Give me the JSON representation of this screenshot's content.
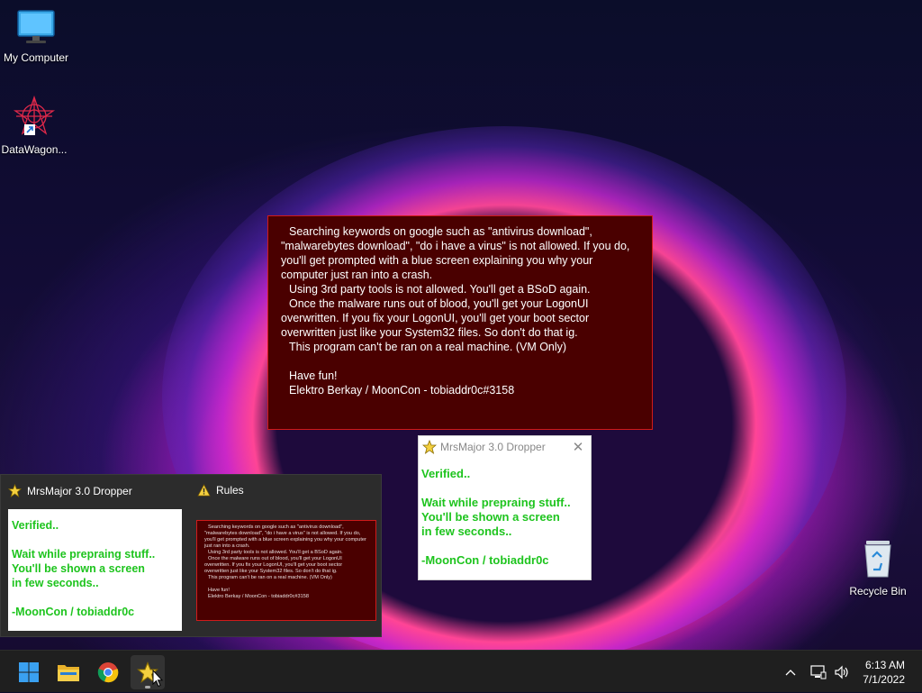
{
  "desktop": {
    "icons": [
      {
        "label": "My Computer"
      },
      {
        "label": "DataWagon..."
      },
      {
        "label": "Recycle Bin"
      }
    ]
  },
  "rules_window": {
    "lines": [
      "Searching keywords on google such as \"antivirus download\", \"malwarebytes download\", \"do i have a virus\" is not allowed. If you do, you'll get prompted with a blue screen explaining you why your computer just ran into a crash.",
      "Using 3rd party tools is not allowed. You'll get a BSoD again.",
      "Once the malware runs out of blood, you'll get your LogonUI overwritten. If you fix your LogonUI, you'll get your boot sector overwritten just like your System32 files. So don't do that ig.",
      "This program can't be ran on a real machine. (VM Only)",
      "Have fun!",
      "Elektro Berkay / MoonCon - tobiaddr0c#3158"
    ]
  },
  "dropper_window": {
    "title": "MrsMajor 3.0 Dropper",
    "line1": "Verified..",
    "line2": "Wait while prepraing stuff..",
    "line3": "You'll be shown a screen",
    "line4": "in few seconds..",
    "line5": "-MoonCon / tobiaddr0c"
  },
  "taskbar_preview": {
    "items": [
      {
        "title": "MrsMajor 3.0 Dropper"
      },
      {
        "title": "Rules"
      }
    ]
  },
  "taskbar": {
    "time": "6:13 AM",
    "date": "7/1/2022"
  },
  "colors": {
    "rules_bg": "#4a0000",
    "rules_border": "#d01a1a",
    "dropper_text": "#1ec41e",
    "taskbar_bg": "#1f1f1f"
  }
}
